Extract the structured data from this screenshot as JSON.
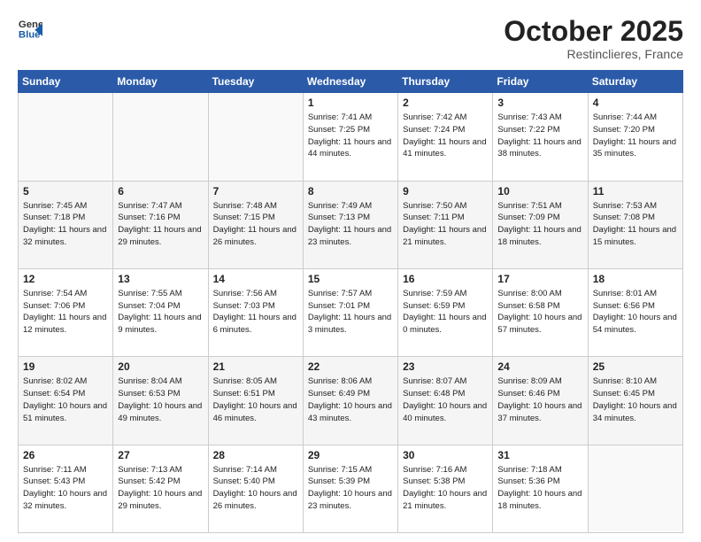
{
  "header": {
    "logo": {
      "text_general": "General",
      "text_blue": "Blue"
    },
    "month": "October 2025",
    "location": "Restinclieres, France"
  },
  "days_of_week": [
    "Sunday",
    "Monday",
    "Tuesday",
    "Wednesday",
    "Thursday",
    "Friday",
    "Saturday"
  ],
  "weeks": [
    [
      {
        "day": "",
        "sunrise": "",
        "sunset": "",
        "daylight": ""
      },
      {
        "day": "",
        "sunrise": "",
        "sunset": "",
        "daylight": ""
      },
      {
        "day": "",
        "sunrise": "",
        "sunset": "",
        "daylight": ""
      },
      {
        "day": "1",
        "sunrise": "Sunrise: 7:41 AM",
        "sunset": "Sunset: 7:25 PM",
        "daylight": "Daylight: 11 hours and 44 minutes."
      },
      {
        "day": "2",
        "sunrise": "Sunrise: 7:42 AM",
        "sunset": "Sunset: 7:24 PM",
        "daylight": "Daylight: 11 hours and 41 minutes."
      },
      {
        "day": "3",
        "sunrise": "Sunrise: 7:43 AM",
        "sunset": "Sunset: 7:22 PM",
        "daylight": "Daylight: 11 hours and 38 minutes."
      },
      {
        "day": "4",
        "sunrise": "Sunrise: 7:44 AM",
        "sunset": "Sunset: 7:20 PM",
        "daylight": "Daylight: 11 hours and 35 minutes."
      }
    ],
    [
      {
        "day": "5",
        "sunrise": "Sunrise: 7:45 AM",
        "sunset": "Sunset: 7:18 PM",
        "daylight": "Daylight: 11 hours and 32 minutes."
      },
      {
        "day": "6",
        "sunrise": "Sunrise: 7:47 AM",
        "sunset": "Sunset: 7:16 PM",
        "daylight": "Daylight: 11 hours and 29 minutes."
      },
      {
        "day": "7",
        "sunrise": "Sunrise: 7:48 AM",
        "sunset": "Sunset: 7:15 PM",
        "daylight": "Daylight: 11 hours and 26 minutes."
      },
      {
        "day": "8",
        "sunrise": "Sunrise: 7:49 AM",
        "sunset": "Sunset: 7:13 PM",
        "daylight": "Daylight: 11 hours and 23 minutes."
      },
      {
        "day": "9",
        "sunrise": "Sunrise: 7:50 AM",
        "sunset": "Sunset: 7:11 PM",
        "daylight": "Daylight: 11 hours and 21 minutes."
      },
      {
        "day": "10",
        "sunrise": "Sunrise: 7:51 AM",
        "sunset": "Sunset: 7:09 PM",
        "daylight": "Daylight: 11 hours and 18 minutes."
      },
      {
        "day": "11",
        "sunrise": "Sunrise: 7:53 AM",
        "sunset": "Sunset: 7:08 PM",
        "daylight": "Daylight: 11 hours and 15 minutes."
      }
    ],
    [
      {
        "day": "12",
        "sunrise": "Sunrise: 7:54 AM",
        "sunset": "Sunset: 7:06 PM",
        "daylight": "Daylight: 11 hours and 12 minutes."
      },
      {
        "day": "13",
        "sunrise": "Sunrise: 7:55 AM",
        "sunset": "Sunset: 7:04 PM",
        "daylight": "Daylight: 11 hours and 9 minutes."
      },
      {
        "day": "14",
        "sunrise": "Sunrise: 7:56 AM",
        "sunset": "Sunset: 7:03 PM",
        "daylight": "Daylight: 11 hours and 6 minutes."
      },
      {
        "day": "15",
        "sunrise": "Sunrise: 7:57 AM",
        "sunset": "Sunset: 7:01 PM",
        "daylight": "Daylight: 11 hours and 3 minutes."
      },
      {
        "day": "16",
        "sunrise": "Sunrise: 7:59 AM",
        "sunset": "Sunset: 6:59 PM",
        "daylight": "Daylight: 11 hours and 0 minutes."
      },
      {
        "day": "17",
        "sunrise": "Sunrise: 8:00 AM",
        "sunset": "Sunset: 6:58 PM",
        "daylight": "Daylight: 10 hours and 57 minutes."
      },
      {
        "day": "18",
        "sunrise": "Sunrise: 8:01 AM",
        "sunset": "Sunset: 6:56 PM",
        "daylight": "Daylight: 10 hours and 54 minutes."
      }
    ],
    [
      {
        "day": "19",
        "sunrise": "Sunrise: 8:02 AM",
        "sunset": "Sunset: 6:54 PM",
        "daylight": "Daylight: 10 hours and 51 minutes."
      },
      {
        "day": "20",
        "sunrise": "Sunrise: 8:04 AM",
        "sunset": "Sunset: 6:53 PM",
        "daylight": "Daylight: 10 hours and 49 minutes."
      },
      {
        "day": "21",
        "sunrise": "Sunrise: 8:05 AM",
        "sunset": "Sunset: 6:51 PM",
        "daylight": "Daylight: 10 hours and 46 minutes."
      },
      {
        "day": "22",
        "sunrise": "Sunrise: 8:06 AM",
        "sunset": "Sunset: 6:49 PM",
        "daylight": "Daylight: 10 hours and 43 minutes."
      },
      {
        "day": "23",
        "sunrise": "Sunrise: 8:07 AM",
        "sunset": "Sunset: 6:48 PM",
        "daylight": "Daylight: 10 hours and 40 minutes."
      },
      {
        "day": "24",
        "sunrise": "Sunrise: 8:09 AM",
        "sunset": "Sunset: 6:46 PM",
        "daylight": "Daylight: 10 hours and 37 minutes."
      },
      {
        "day": "25",
        "sunrise": "Sunrise: 8:10 AM",
        "sunset": "Sunset: 6:45 PM",
        "daylight": "Daylight: 10 hours and 34 minutes."
      }
    ],
    [
      {
        "day": "26",
        "sunrise": "Sunrise: 7:11 AM",
        "sunset": "Sunset: 5:43 PM",
        "daylight": "Daylight: 10 hours and 32 minutes."
      },
      {
        "day": "27",
        "sunrise": "Sunrise: 7:13 AM",
        "sunset": "Sunset: 5:42 PM",
        "daylight": "Daylight: 10 hours and 29 minutes."
      },
      {
        "day": "28",
        "sunrise": "Sunrise: 7:14 AM",
        "sunset": "Sunset: 5:40 PM",
        "daylight": "Daylight: 10 hours and 26 minutes."
      },
      {
        "day": "29",
        "sunrise": "Sunrise: 7:15 AM",
        "sunset": "Sunset: 5:39 PM",
        "daylight": "Daylight: 10 hours and 23 minutes."
      },
      {
        "day": "30",
        "sunrise": "Sunrise: 7:16 AM",
        "sunset": "Sunset: 5:38 PM",
        "daylight": "Daylight: 10 hours and 21 minutes."
      },
      {
        "day": "31",
        "sunrise": "Sunrise: 7:18 AM",
        "sunset": "Sunset: 5:36 PM",
        "daylight": "Daylight: 10 hours and 18 minutes."
      },
      {
        "day": "",
        "sunrise": "",
        "sunset": "",
        "daylight": ""
      }
    ]
  ]
}
